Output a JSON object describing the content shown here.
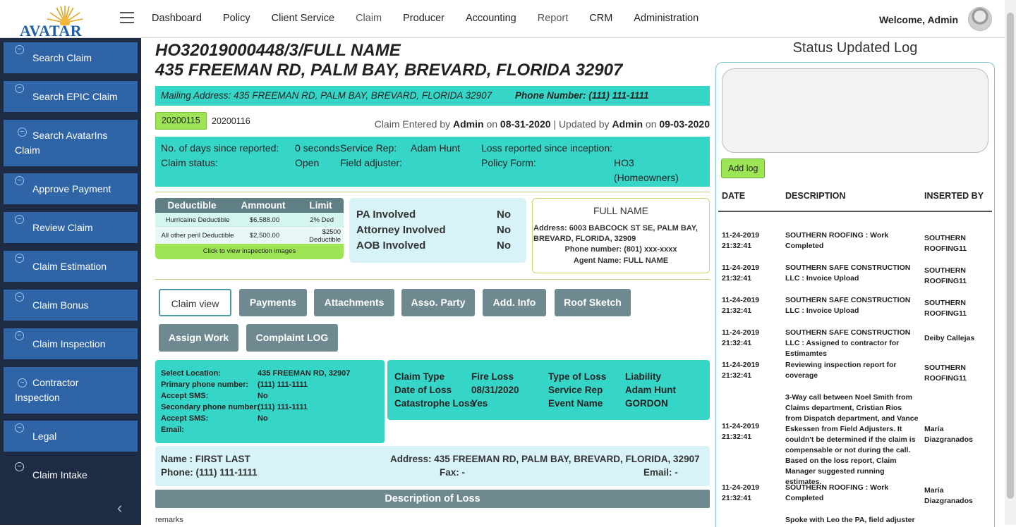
{
  "brand": {
    "name": "AVATAR"
  },
  "nav": {
    "items": [
      "Dashboard",
      "Policy",
      "Client Service",
      "Claim",
      "Producer",
      "Accounting",
      "Report",
      "CRM",
      "Administration"
    ],
    "welcome": "Welcome, Admin"
  },
  "sidebar": {
    "items": [
      "Search Claim",
      "Search EPIC Claim",
      "Search AvatarIns Claim",
      "Approve Payment",
      "Review Claim",
      "Claim Estimation",
      "Claim Bonus",
      "Claim Inspection",
      "Contractor Inspection",
      "Legal",
      "Claim Intake"
    ]
  },
  "header": {
    "title": "HO32019000448/3/FULL NAME",
    "address": "435 FREEMAN RD, PALM BAY, BREVARD, FLORIDA 32907"
  },
  "mailing": {
    "label": "Mailing Address: 435 FREEMAN RD, PALM BAY, BREVARD, FLORIDA 32907",
    "phone": "Phone Number: (111) 111-1111"
  },
  "claim_ids": {
    "active": "20200115",
    "other": "20200116"
  },
  "entered": {
    "entered_label": "Claim Entered by",
    "entered_by": "Admin",
    "on1": "on",
    "entered_date": "08-31-2020",
    "updated_label": "| Updated by",
    "updated_by": "Admin",
    "on2": "on",
    "updated_date": "09-03-2020"
  },
  "info": {
    "days_label": "No. of days since reported:",
    "days_value": "0 seconds",
    "status_label": "Claim status:",
    "status_value": "Open",
    "rep_label": "Service Rep:",
    "rep_value": "Adam Hunt",
    "adjuster_label": "Field adjuster:",
    "loss_label": "Loss reported since inception:",
    "form_label": "Policy Form:",
    "form_value1": "HO3",
    "form_value2": "(Homeowners)"
  },
  "deductible": {
    "headers": [
      "Deductible",
      "Ammount",
      "Limit"
    ],
    "rows": [
      [
        "Hurricaine Deductible",
        "$6,588.00",
        "2% Ded"
      ],
      [
        "All other peril Deductible",
        "$2,500.00",
        "$2500 Deductible"
      ]
    ],
    "button": "Click to view inspection images"
  },
  "involved": {
    "pa": "PA Involved",
    "pa_v": "No",
    "attorney": "Attorney Involved",
    "attorney_v": "No",
    "aob": "AOB Involved",
    "aob_v": "No"
  },
  "agent": {
    "name": "FULL NAME",
    "address": "Address: 6003 BABCOCK ST SE, PALM BAY, BREVARD, FLORIDA, 32909",
    "phone": "Phone number: (801) xxx-xxxx",
    "agent": "Agent Name: FULL NAME"
  },
  "tabs": [
    "Claim view",
    "Payments",
    "Attachments",
    "Asso. Party",
    "Add. Info",
    "Roof Sketch",
    "Assign Work",
    "Complaint LOG"
  ],
  "location": {
    "loc_label": "Select Location:",
    "loc_value": "435 FREEMAN RD, 32907",
    "pp_label": "Primary phone number:",
    "pp_value": "(111) 111-1111",
    "sms1_label": "Accept SMS:",
    "sms1_value": "No",
    "sp_label": "Secondary phone number:",
    "sp_value": "(111) 111-1111",
    "sms2_label": "Accept SMS:",
    "sms2_value": "No",
    "email_label": "Email:"
  },
  "claim": {
    "type_label": "Claim Type",
    "type_value": "Fire Loss",
    "date_label": "Date of Loss",
    "date_value": "08/31/2020",
    "cat_label": "Catastrophe Loss",
    "cat_value": "Yes",
    "tol_label": "Type of Loss",
    "tol_value": "Liability",
    "rep_label": "Service Rep",
    "rep_value": "Adam Hunt",
    "event_label": "Event Name",
    "event_value": "GORDON"
  },
  "insured": {
    "name": "Name : FIRST LAST",
    "phone": "Phone: (111) 111-1111",
    "address": "Address: 435 FREEMAN RD, PALM BAY, BREVARD, FLORIDA, 32907",
    "fax": "Fax: -",
    "email": "Email: -"
  },
  "description": {
    "title": "Description of Loss",
    "remarks": "remarks"
  },
  "log": {
    "title": "Status Updated Log",
    "add_button": "Add log",
    "headers": [
      "DATE",
      "DESCRIPTION",
      "INSERTED BY"
    ],
    "rows": [
      {
        "date": "11-24-2019 21:32:41",
        "desc": "SOUTHERN ROOFING : Work Completed",
        "by": "SOUTHERN ROOFING11"
      },
      {
        "date": "11-24-2019 21:32:41",
        "desc": "SOUTHERN SAFE CONSTRUCTION LLC : Invoice Upload",
        "by": "SOUTHERN ROOFING11"
      },
      {
        "date": "11-24-2019 21:32:41",
        "desc": "SOUTHERN SAFE CONSTRUCTION LLC : Invoice Upload",
        "by": "SOUTHERN ROOFING11"
      },
      {
        "date": "11-24-2019 21:32:41",
        "desc": "SOUTHERN SAFE CONSTRUCTION LLC : Assigned to contractor for Estimamtes",
        "by": "Deiby Callejas"
      },
      {
        "date": "11-24-2019 21:32:41",
        "desc": "Reviewing inspection report for coverage",
        "by": "SOUTHERN ROOFING11"
      },
      {
        "date": "11-24-2019 21:32:41",
        "desc": "3-Way call between Noel Smith from Claims department, Cristian Rios from Dispatch department, and Vance Eskessen from Field Adjusters. It couldn't be determined if the claim is compensable or not during the call. Based on the loss report, Claim Manager suggested running estimates.",
        "by": "María Diazgranados"
      },
      {
        "date": "11-24-2019 21:32:41",
        "desc": "SOUTHERN ROOFING : Work Completed",
        "by": "María Diazgranados"
      },
      {
        "date": "",
        "desc": "Spoke with Leo the PA, field adjuster",
        "by": ""
      }
    ]
  }
}
